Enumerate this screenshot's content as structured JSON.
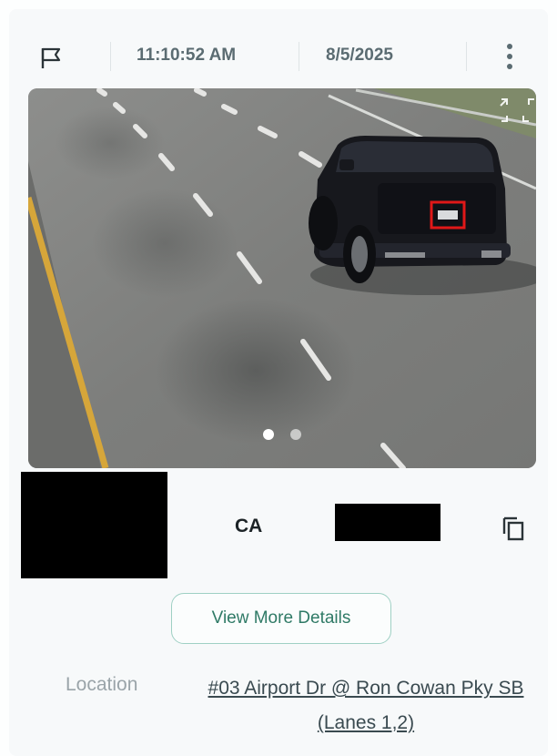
{
  "header": {
    "time": "11:10:52 AM",
    "date": "8/5/2025",
    "flag_icon": "flag-icon",
    "menu_icon": "kebab-menu-icon"
  },
  "image": {
    "carousel_count": 2,
    "active_index": 0,
    "expand_icon": "expand-icon"
  },
  "plate": {
    "state": "CA",
    "copy_icon": "copy-icon"
  },
  "actions": {
    "view_details": "View More Details"
  },
  "location": {
    "label": "Location",
    "value": "#03 Airport Dr @ Ron Cowan Pky SB (Lanes 1,2)"
  },
  "colors": {
    "accent": "#2f7a66",
    "accent_border": "#9fd0c4",
    "text_muted": "#5b6c72",
    "plate_highlight": "#e01818"
  }
}
